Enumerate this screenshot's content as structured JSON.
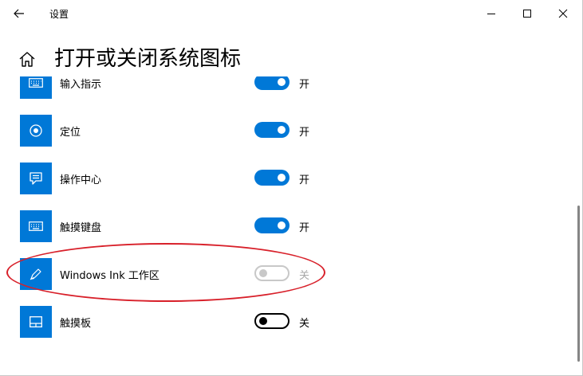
{
  "window": {
    "title": "设置"
  },
  "page": {
    "title": "打开或关闭系统图标"
  },
  "items": [
    {
      "label": "输入指示",
      "state_label": "开",
      "on": true,
      "disabled": false
    },
    {
      "label": "定位",
      "state_label": "开",
      "on": true,
      "disabled": false
    },
    {
      "label": "操作中心",
      "state_label": "开",
      "on": true,
      "disabled": false
    },
    {
      "label": "触摸键盘",
      "state_label": "开",
      "on": true,
      "disabled": false
    },
    {
      "label": "Windows Ink 工作区",
      "state_label": "关",
      "on": false,
      "disabled": true
    },
    {
      "label": "触摸板",
      "state_label": "关",
      "on": false,
      "disabled": false
    }
  ],
  "colors": {
    "accent": "#0078d7",
    "highlight_ellipse": "#d8202a"
  }
}
